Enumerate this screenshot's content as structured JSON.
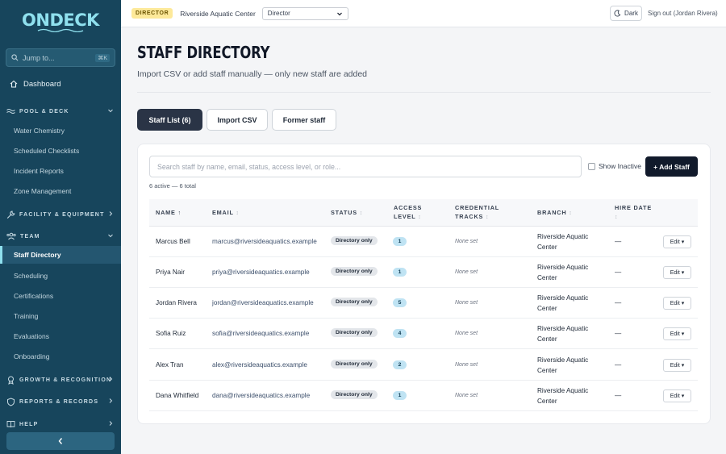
{
  "app": {
    "logo_text": "ONDECK"
  },
  "sidebar": {
    "jump_placeholder": "Jump to...",
    "jump_shortcut": "⌘K",
    "dashboard": "Dashboard",
    "sections": {
      "pool": "POOL & DECK",
      "facility": "FACILITY & EQUIPMENT",
      "team": "TEAM",
      "growth": "GROWTH & RECOGNITION",
      "reports": "REPORTS & RECORDS",
      "help": "HELP"
    },
    "pool_items": [
      "Water Chemistry",
      "Scheduled Checklists",
      "Incident Reports",
      "Zone Management"
    ],
    "team_items": [
      "Staff Directory",
      "Scheduling",
      "Certifications",
      "Training",
      "Evaluations",
      "Onboarding"
    ],
    "active_item": "Staff Directory"
  },
  "topbar": {
    "role_badge": "DIRECTOR",
    "center_name": "Riverside Aquatic Center",
    "role_select_value": "Director",
    "theme_toggle": "Dark",
    "signout": "Sign out (Jordan Rivera)"
  },
  "page": {
    "title": "STAFF DIRECTORY",
    "subtitle": "Import CSV or add staff manually — only new staff are added"
  },
  "tabs": [
    "Staff List (6)",
    "Import CSV",
    "Former staff"
  ],
  "toolbar": {
    "search_placeholder": "Search staff by name, email, status, access level, or role...",
    "show_inactive": "Show Inactive",
    "add_staff": "+ Add Staff",
    "count_text": "6 active — 6 total"
  },
  "table": {
    "headers": {
      "name": "NAME",
      "name_sort": "↑",
      "email": "EMAIL",
      "status": "STATUS",
      "access_1": "ACCESS",
      "access_2": "LEVEL",
      "cred_1": "CREDENTIAL",
      "cred_2": "TRACKS",
      "branch": "BRANCH",
      "hire": "HIRE DATE"
    },
    "rows": [
      {
        "name": "Marcus Bell",
        "email": "marcus@riversideaquatics.example",
        "status": "Directory only",
        "level": "1",
        "credentials": "None set",
        "branch_1": "Riverside Aquatic",
        "branch_2": "Center",
        "hire": "—",
        "action": "Edit ▾"
      },
      {
        "name": "Priya Nair",
        "email": "priya@riversideaquatics.example",
        "status": "Directory only",
        "level": "1",
        "credentials": "None set",
        "branch_1": "Riverside Aquatic",
        "branch_2": "Center",
        "hire": "—",
        "action": "Edit ▾"
      },
      {
        "name": "Jordan Rivera",
        "email": "jordan@riversideaquatics.example",
        "status": "Directory only",
        "level": "5",
        "credentials": "None set",
        "branch_1": "Riverside Aquatic",
        "branch_2": "Center",
        "hire": "—",
        "action": "Edit ▾"
      },
      {
        "name": "Sofia Ruiz",
        "email": "sofia@riversideaquatics.example",
        "status": "Directory only",
        "level": "4",
        "credentials": "None set",
        "branch_1": "Riverside Aquatic",
        "branch_2": "Center",
        "hire": "—",
        "action": "Edit ▾"
      },
      {
        "name": "Alex Tran",
        "email": "alex@riversideaquatics.example",
        "status": "Directory only",
        "level": "2",
        "credentials": "None set",
        "branch_1": "Riverside Aquatic",
        "branch_2": "Center",
        "hire": "—",
        "action": "Edit ▾"
      },
      {
        "name": "Dana Whitfield",
        "email": "dana@riversideaquatics.example",
        "status": "Directory only",
        "level": "1",
        "credentials": "None set",
        "branch_1": "Riverside Aquatic",
        "branch_2": "Center",
        "hire": "—",
        "action": "Edit ▾"
      }
    ]
  },
  "colors": {
    "sidebar": "#17455c",
    "accent": "#8fe0ee",
    "primary_button": "#111a2b",
    "badge": "#fde99a"
  }
}
